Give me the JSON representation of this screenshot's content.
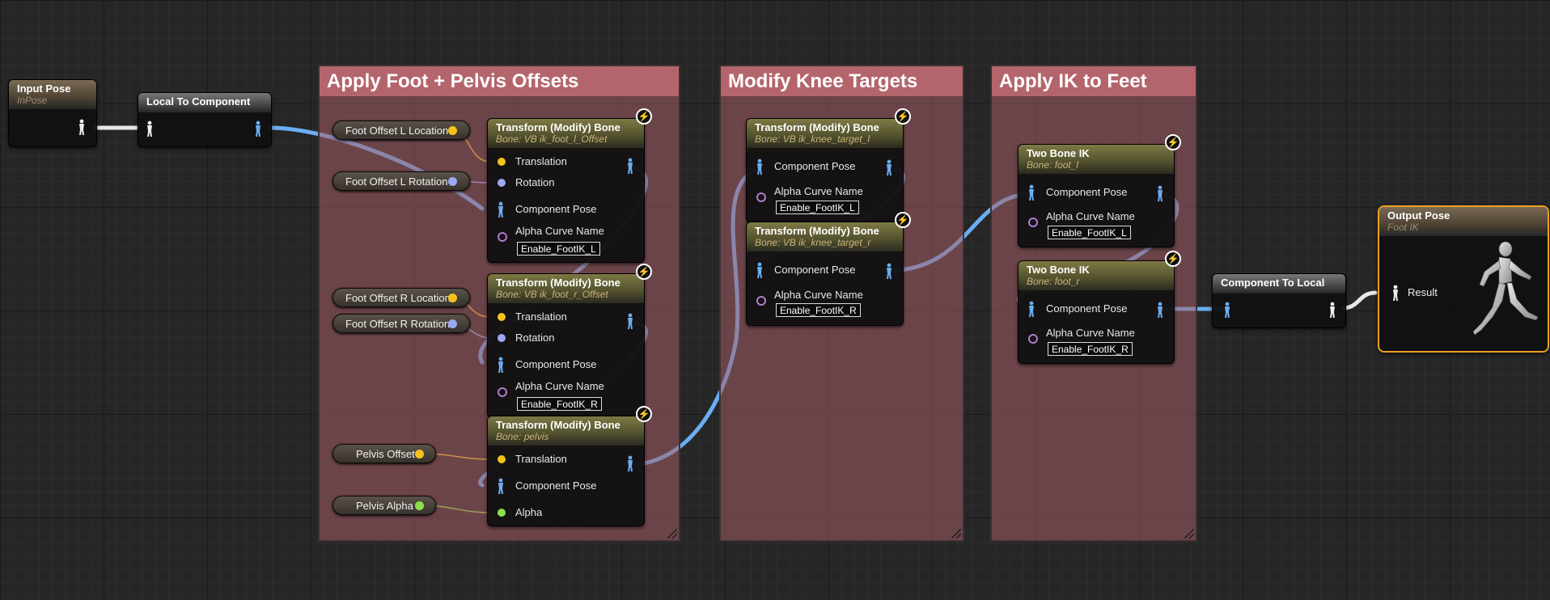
{
  "comments": {
    "foot_pelvis": "Apply Foot + Pelvis Offsets",
    "knee": "Modify Knee Targets",
    "ik_feet": "Apply IK to Feet"
  },
  "nodes": {
    "input_pose": {
      "title": "Input Pose",
      "subtitle": "InPose"
    },
    "local_to_component": {
      "title": "Local To Component"
    },
    "component_to_local": {
      "title": "Component To Local"
    },
    "output_pose": {
      "title": "Output Pose",
      "subtitle": "Foot IK",
      "result_label": "Result"
    },
    "foot_l_offset": {
      "title": "Transform (Modify) Bone",
      "bone": "Bone: VB ik_foot_l_Offset",
      "alpha_curve": "Enable_FootIK_L"
    },
    "foot_r_offset": {
      "title": "Transform (Modify) Bone",
      "bone": "Bone: VB ik_foot_r_Offset",
      "alpha_curve": "Enable_FootIK_R"
    },
    "pelvis": {
      "title": "Transform (Modify) Bone",
      "bone": "Bone: pelvis"
    },
    "knee_l": {
      "title": "Transform (Modify) Bone",
      "bone": "Bone: VB ik_knee_target_l",
      "alpha_curve": "Enable_FootIK_L"
    },
    "knee_r": {
      "title": "Transform (Modify) Bone",
      "bone": "Bone: VB ik_knee_target_r",
      "alpha_curve": "Enable_FootIK_R"
    },
    "two_bone_l": {
      "title": "Two Bone IK",
      "bone": "Bone: foot_l",
      "alpha_curve": "Enable_FootIK_L"
    },
    "two_bone_r": {
      "title": "Two Bone IK",
      "bone": "Bone: foot_r",
      "alpha_curve": "Enable_FootIK_R"
    }
  },
  "pins": {
    "translation": "Translation",
    "rotation": "Rotation",
    "component_pose": "Component Pose",
    "alpha_curve_name": "Alpha Curve Name",
    "alpha": "Alpha"
  },
  "variables": {
    "foot_l_location": "Foot Offset L Location",
    "foot_l_rotation": "Foot Offset L Rotation",
    "foot_r_location": "Foot Offset R Location",
    "foot_r_rotation": "Foot Offset R Rotation",
    "pelvis_offset": "Pelvis Offset",
    "pelvis_alpha": "Pelvis Alpha"
  },
  "colors": {
    "pose_wire": "#6aaef2",
    "vector_pin": "#f5c21b",
    "rotator_pin": "#9aa8f5",
    "float_pin": "#8be04a",
    "name_pin": "#b07ad0",
    "output_border": "#f0a020"
  }
}
